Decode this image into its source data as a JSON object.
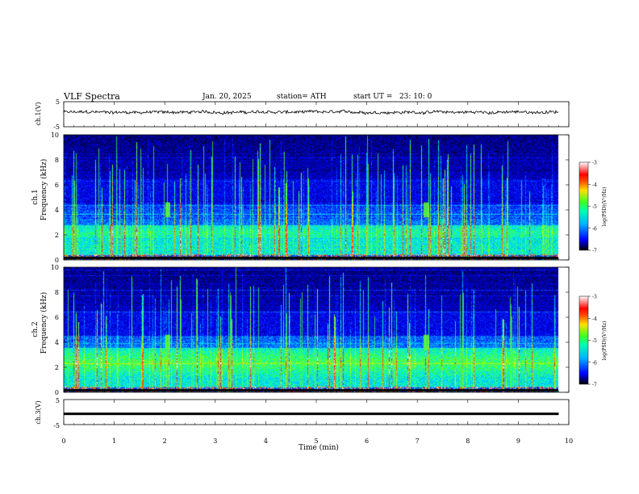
{
  "header": {
    "title": "VLF Spectra",
    "date": "Jan. 20, 2025",
    "station": "station= ATH",
    "start": "start UT =   23: 10: 0"
  },
  "chart_data": [
    {
      "type": "line",
      "name": "ch1-waveform",
      "ylabel": "ch.1(V)",
      "ylim": [
        -5,
        5
      ],
      "yticks": [
        "5",
        "-5"
      ],
      "x_range_min": [
        0,
        9.8
      ],
      "baseline_v": 0.8,
      "noise_amp_v": 0.8
    },
    {
      "type": "heatmap",
      "name": "ch1-spectrogram",
      "ylabel": [
        "ch.1",
        "Frequency (kHz)"
      ],
      "ylim": [
        0,
        10
      ],
      "yticks": [
        "0",
        "2",
        "4",
        "6",
        "8",
        "10"
      ],
      "x_range_min": [
        0,
        9.8
      ],
      "bright_band_khz": [
        1.6,
        2.8
      ],
      "event_times_min": [
        2.05,
        7.15
      ],
      "colorbar": {
        "label": "log(PSD)(V²/Hz)",
        "range": [
          -7,
          -3
        ],
        "ticks": [
          "-3",
          "-4",
          "-5",
          "-6",
          "-7"
        ]
      }
    },
    {
      "type": "heatmap",
      "name": "ch2-spectrogram",
      "ylabel": [
        "ch.2",
        "Frequency (kHz)"
      ],
      "ylim": [
        0,
        10
      ],
      "yticks": [
        "0",
        "2",
        "4",
        "6",
        "8",
        "10"
      ],
      "x_range_min": [
        0,
        9.8
      ],
      "bright_band_khz": [
        1.2,
        3.6
      ],
      "event_times_min": [
        2.05,
        7.15
      ],
      "colorbar": {
        "label": "log(PSD)(V²/Hz)",
        "range": [
          -7,
          -3
        ],
        "ticks": [
          "-3",
          "-4",
          "-5",
          "-6",
          "-7"
        ]
      }
    },
    {
      "type": "line",
      "name": "ch3-waveform",
      "ylabel": "ch.3(V)",
      "ylim": [
        -5,
        5
      ],
      "yticks": [
        "5",
        "-5"
      ],
      "x_range_min": [
        0,
        9.8
      ],
      "baseline_v": -0.7
    }
  ],
  "xaxis": {
    "label": "Time (min)",
    "range": [
      0,
      10
    ],
    "ticks": [
      "0",
      "1",
      "2",
      "3",
      "4",
      "5",
      "6",
      "7",
      "8",
      "9",
      "10"
    ]
  },
  "colors": {
    "colormap": [
      "#000000",
      "#00008c",
      "#0000ff",
      "#0090ff",
      "#00ffff",
      "#40ff40",
      "#d0ff00",
      "#ff8000",
      "#ff0000",
      "#ffffff"
    ]
  }
}
